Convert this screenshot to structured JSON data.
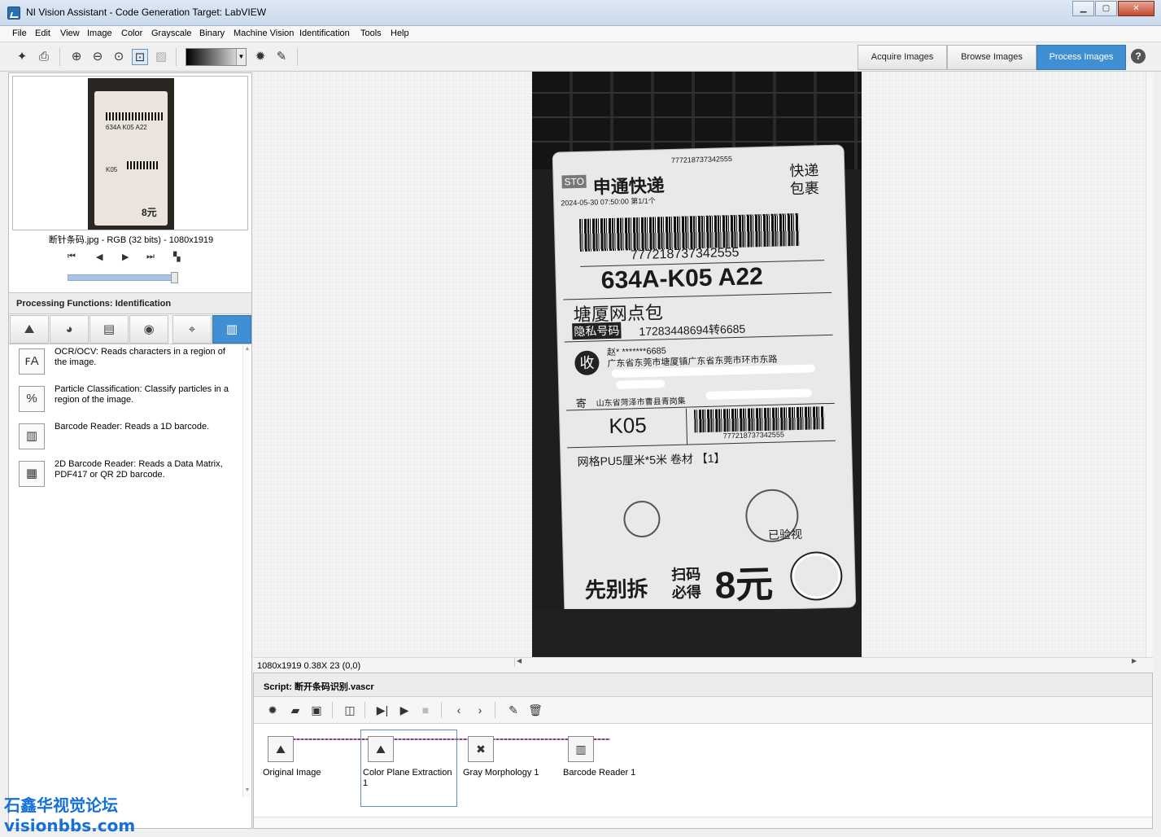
{
  "window": {
    "title": "NI Vision Assistant - Code Generation Target: LabVIEW",
    "minimize": "▁",
    "maximize": "▢",
    "close": "✕"
  },
  "menu": [
    "File",
    "Edit",
    "View",
    "Image",
    "Color",
    "Grayscale",
    "Binary",
    "Machine Vision",
    "Identification",
    "Tools",
    "Help"
  ],
  "toolbar": {
    "icons": [
      "acquire-image-icon",
      "save-image-icon",
      "zoom-in-icon",
      "zoom-out-icon",
      "zoom-1to1-icon",
      "zoom-fit-icon",
      "image-overlay-icon",
      "threshold-icon",
      "edit-palette-icon"
    ],
    "palette": "gray gradient"
  },
  "mode_tabs": [
    {
      "label": "Acquire Images",
      "active": false
    },
    {
      "label": "Browse Images",
      "active": false
    },
    {
      "label": "Process Images",
      "active": true
    }
  ],
  "help": "?",
  "image_browser": {
    "caption": "断针条码.jpg - RGB (32 bits) - 1080x1919",
    "thumb_texts": [
      "634A K05 A22",
      "K05",
      "8元"
    ],
    "nav": [
      "⏮",
      "◀",
      "▶",
      "⏭",
      "▚"
    ]
  },
  "processing": {
    "title": "Processing Functions: Identification",
    "categories": [
      "image-icon",
      "color-icon",
      "grayscale-icon",
      "binary-icon",
      "machine-vision-icon",
      "identification-icon"
    ],
    "functions": [
      {
        "icon": "ocr-icon",
        "glyph": "ꜰA",
        "text": "OCR/OCV:  Reads characters in a region of the image."
      },
      {
        "icon": "particle-classification-icon",
        "glyph": "%",
        "text": "Particle Classification:  Classify particles in a region of the image."
      },
      {
        "icon": "barcode-icon",
        "glyph": "▥",
        "text": "Barcode Reader:  Reads a 1D barcode."
      },
      {
        "icon": "2d-barcode-icon",
        "glyph": "▦",
        "text": "2D Barcode Reader:  Reads a Data Matrix, PDF417 or QR 2D barcode."
      }
    ]
  },
  "image_view": {
    "label_texts": {
      "brand": "申通快递",
      "express": "快递",
      "pack": "包裹",
      "track_small": "777218737342555",
      "date": "2024-05-30 07:50:00  第1/1个",
      "tracking": "777218737342555",
      "code": "634A-K05  A22",
      "station": "塘厦网点包",
      "privacy": "隐私号码",
      "phone": "17283448694转6685",
      "recv": "收",
      "recv_name": "赵*  *******6685",
      "recv_addr": "广东省东莞市塘厦镇广东省东莞市环市东路",
      "send": "寄",
      "send_addr": "山东省菏泽市曹县青岗集",
      "k05": "K05",
      "track_bottom": "777218737342555",
      "goods": "网格PU5厘米*5米 卷材  【1】",
      "checked": "已验视",
      "promo": "先别拆",
      "scan": "扫码",
      "get": "必得",
      "yuan": "8元"
    }
  },
  "status": {
    "info": "1080x1919 0.38X 23    (0,0)"
  },
  "script": {
    "title": "Script: 断开条码识别.vascr",
    "toolbar_icons": [
      "new-script-icon",
      "open-script-icon",
      "save-script-icon",
      "comment-icon",
      "run-once-icon",
      "run-icon",
      "stop-icon",
      "step-back-icon",
      "step-forward-icon",
      "edit-step-icon",
      "delete-step-icon"
    ],
    "steps": [
      {
        "label": "Original Image",
        "icon": "original-image-icon"
      },
      {
        "label": "Color Plane Extraction 1",
        "icon": "color-plane-extraction-icon"
      },
      {
        "label": "Gray Morphology 1",
        "icon": "gray-morphology-icon"
      },
      {
        "label": "Barcode Reader 1",
        "icon": "barcode-reader-step-icon"
      }
    ]
  },
  "watermark": {
    "line1": "石鑫华视觉论坛",
    "line2": "visionbbs.com"
  }
}
